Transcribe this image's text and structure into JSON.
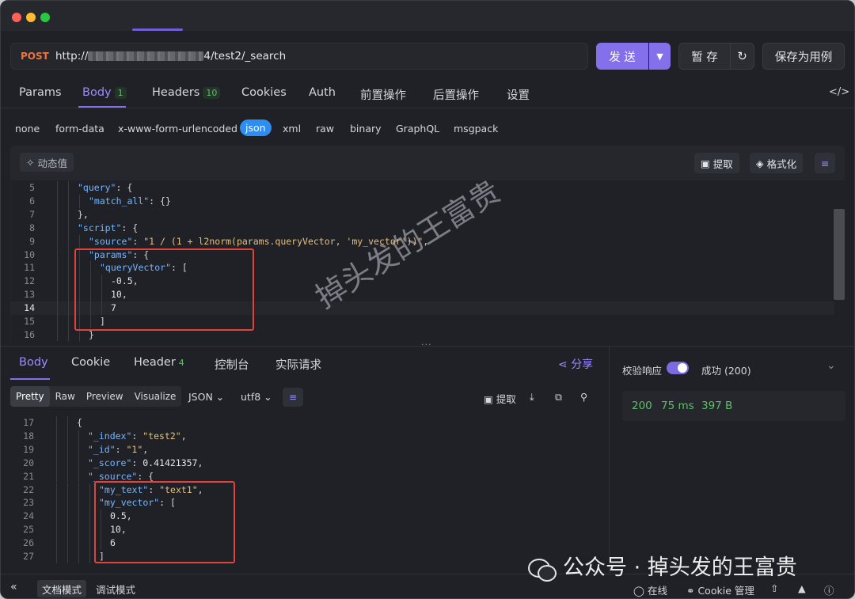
{
  "request": {
    "method": "POST",
    "url_prefix": "http://",
    "url_suffix": "4/test2/_search",
    "send_label": "发 送",
    "save_label": "暂 存",
    "save_case_label": "保存为用例"
  },
  "request_tabs": [
    {
      "label": "Params"
    },
    {
      "label": "Body",
      "badge": "1"
    },
    {
      "label": "Headers",
      "badge": "10"
    },
    {
      "label": "Cookies"
    },
    {
      "label": "Auth"
    },
    {
      "label": "前置操作"
    },
    {
      "label": "后置操作"
    },
    {
      "label": "设置"
    }
  ],
  "body_types": [
    "none",
    "form-data",
    "x-www-form-urlencoded",
    "json",
    "xml",
    "raw",
    "binary",
    "GraphQL",
    "msgpack"
  ],
  "active_body_type": "json",
  "editor_toolbar": {
    "dynamic_value": "动态值",
    "extract": "提取",
    "format": "格式化"
  },
  "request_code": [
    {
      "n": "5",
      "indent": 6,
      "parts": [
        [
          "k",
          "\"query\""
        ],
        [
          "p",
          ": {"
        ]
      ]
    },
    {
      "n": "6",
      "indent": 8,
      "parts": [
        [
          "k",
          "\"match_all\""
        ],
        [
          "p",
          ": {}"
        ]
      ]
    },
    {
      "n": "7",
      "indent": 6,
      "parts": [
        [
          "p",
          "},"
        ]
      ]
    },
    {
      "n": "8",
      "indent": 6,
      "parts": [
        [
          "k",
          "\"script\""
        ],
        [
          "p",
          ": {"
        ]
      ]
    },
    {
      "n": "9",
      "indent": 8,
      "parts": [
        [
          "k",
          "\"source\""
        ],
        [
          "p",
          ": "
        ],
        [
          "s",
          "\"1 / (1 + l2norm(params.queryVector, 'my_vector'))\""
        ],
        [
          "p",
          ","
        ]
      ]
    },
    {
      "n": "10",
      "indent": 8,
      "parts": [
        [
          "k",
          "\"params\""
        ],
        [
          "p",
          ": {"
        ]
      ]
    },
    {
      "n": "11",
      "indent": 10,
      "parts": [
        [
          "k",
          "\"queryVector\""
        ],
        [
          "p",
          ": ["
        ]
      ]
    },
    {
      "n": "12",
      "indent": 12,
      "parts": [
        [
          "n",
          "-0.5"
        ],
        [
          "p",
          ","
        ]
      ]
    },
    {
      "n": "13",
      "indent": 12,
      "parts": [
        [
          "n",
          "10"
        ],
        [
          "p",
          ","
        ]
      ]
    },
    {
      "n": "14",
      "indent": 12,
      "parts": [
        [
          "n",
          "7"
        ]
      ],
      "current": true
    },
    {
      "n": "15",
      "indent": 10,
      "parts": [
        [
          "p",
          "]"
        ]
      ]
    },
    {
      "n": "16",
      "indent": 8,
      "parts": [
        [
          "p",
          "}"
        ]
      ]
    }
  ],
  "response_tabs": [
    {
      "label": "Body"
    },
    {
      "label": "Cookie"
    },
    {
      "label": "Header",
      "badge": "4"
    },
    {
      "label": "控制台"
    },
    {
      "label": "实际请求"
    }
  ],
  "share_label": "分享",
  "view_modes": [
    "Pretty",
    "Raw",
    "Preview",
    "Visualize"
  ],
  "format_select": "JSON",
  "encoding_select": "utf8",
  "response_extract": "提取",
  "response_code": [
    {
      "n": "17",
      "indent": 6,
      "parts": [
        [
          "p",
          "{"
        ]
      ]
    },
    {
      "n": "18",
      "indent": 8,
      "parts": [
        [
          "k",
          "\"_index\""
        ],
        [
          "p",
          ": "
        ],
        [
          "s",
          "\"test2\""
        ],
        [
          "p",
          ","
        ]
      ]
    },
    {
      "n": "19",
      "indent": 8,
      "parts": [
        [
          "k",
          "\"_id\""
        ],
        [
          "p",
          ": "
        ],
        [
          "s",
          "\"1\""
        ],
        [
          "p",
          ","
        ]
      ]
    },
    {
      "n": "20",
      "indent": 8,
      "parts": [
        [
          "k",
          "\"_score\""
        ],
        [
          "p",
          ": "
        ],
        [
          "n",
          "0.41421357"
        ],
        [
          "p",
          ","
        ]
      ]
    },
    {
      "n": "21",
      "indent": 8,
      "parts": [
        [
          "k",
          "\"_source\""
        ],
        [
          "p",
          ": {"
        ]
      ]
    },
    {
      "n": "22",
      "indent": 10,
      "parts": [
        [
          "k",
          "\"my_text\""
        ],
        [
          "p",
          ": "
        ],
        [
          "s",
          "\"text1\""
        ],
        [
          "p",
          ","
        ]
      ]
    },
    {
      "n": "23",
      "indent": 10,
      "parts": [
        [
          "k",
          "\"my_vector\""
        ],
        [
          "p",
          ": ["
        ]
      ]
    },
    {
      "n": "24",
      "indent": 12,
      "parts": [
        [
          "n",
          "0.5"
        ],
        [
          "p",
          ","
        ]
      ]
    },
    {
      "n": "25",
      "indent": 12,
      "parts": [
        [
          "n",
          "10"
        ],
        [
          "p",
          ","
        ]
      ]
    },
    {
      "n": "26",
      "indent": 12,
      "parts": [
        [
          "n",
          "6"
        ]
      ]
    },
    {
      "n": "27",
      "indent": 10,
      "parts": [
        [
          "p",
          "]"
        ]
      ]
    }
  ],
  "verify": {
    "label": "校验响应",
    "enabled": true,
    "result": "成功 (200)"
  },
  "stats": {
    "status": "200",
    "time": "75 ms",
    "size": "397 B"
  },
  "footer": {
    "doc_mode": "文档模式",
    "debug_mode": "调试模式",
    "online": "在线",
    "cookie": "Cookie 管理"
  },
  "watermark_diagonal": "掉头发的王富贵",
  "watermark_brand": "公众号 · 掉头发的王富贵",
  "colors": {
    "accent": "#8370ea",
    "method": "#f0743c",
    "success": "#5fbf6b",
    "highlight_box": "#e0423c"
  }
}
